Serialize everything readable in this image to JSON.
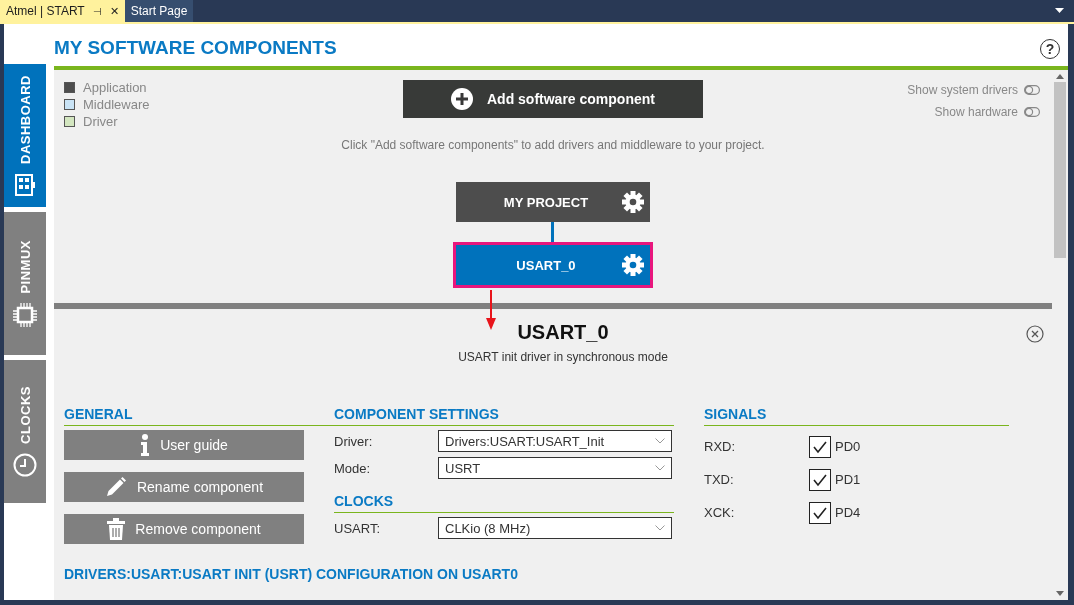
{
  "tabs": [
    {
      "label": "Atmel | START",
      "selected": true,
      "pin": "⊣",
      "close": "✕"
    },
    {
      "label": "Start Page",
      "selected": false
    }
  ],
  "sidebar": [
    {
      "label": "DASHBOARD",
      "kind": "dashboard",
      "selected": true
    },
    {
      "label": "PINMUX",
      "kind": "chip",
      "selected": false
    },
    {
      "label": "CLOCKS",
      "kind": "clock",
      "selected": false
    }
  ],
  "header": {
    "title": "MY SOFTWARE COMPONENTS",
    "help": "?"
  },
  "legend": [
    {
      "label": "Application",
      "color": "#4d4d4d"
    },
    {
      "label": "Middleware",
      "color": "#c9e3f5"
    },
    {
      "label": "Driver",
      "color": "#d3e6c0"
    }
  ],
  "add_button": "Add software component",
  "toggles": [
    {
      "label": "Show system drivers",
      "on": false
    },
    {
      "label": "Show hardware",
      "on": false
    }
  ],
  "hint": "Click \"Add software components\" to add drivers and middleware to your project.",
  "tree": {
    "label": "MY PROJECT",
    "selected": false,
    "children": [
      {
        "label": "USART_0",
        "selected": true,
        "highlighted": true
      }
    ]
  },
  "details": {
    "title": "USART_0",
    "description": "USART init driver in synchronous mode",
    "general": {
      "heading": "GENERAL",
      "buttons": [
        {
          "label": "User guide",
          "kind": "info"
        },
        {
          "label": "Rename component",
          "kind": "pencil"
        },
        {
          "label": "Remove component",
          "kind": "trash"
        }
      ]
    },
    "settings": {
      "heading": "COMPONENT SETTINGS",
      "fields": [
        {
          "label": "Driver:",
          "value": "Drivers:USART:USART_Init"
        },
        {
          "label": "Mode:",
          "value": "USRT"
        }
      ]
    },
    "clocks": {
      "heading": "CLOCKS",
      "fields": [
        {
          "label": "USART:",
          "value": "CLKio (8 MHz)"
        }
      ]
    },
    "signals": {
      "heading": "SIGNALS",
      "rows": [
        {
          "label": "RXD:",
          "pin": "PD0",
          "checked": true
        },
        {
          "label": "TXD:",
          "pin": "PD1",
          "checked": true
        },
        {
          "label": "XCK:",
          "pin": "PD4",
          "checked": true
        }
      ]
    },
    "config_heading": "DRIVERS:USART:USART INIT (USRT) CONFIGURATION ON USART0"
  }
}
